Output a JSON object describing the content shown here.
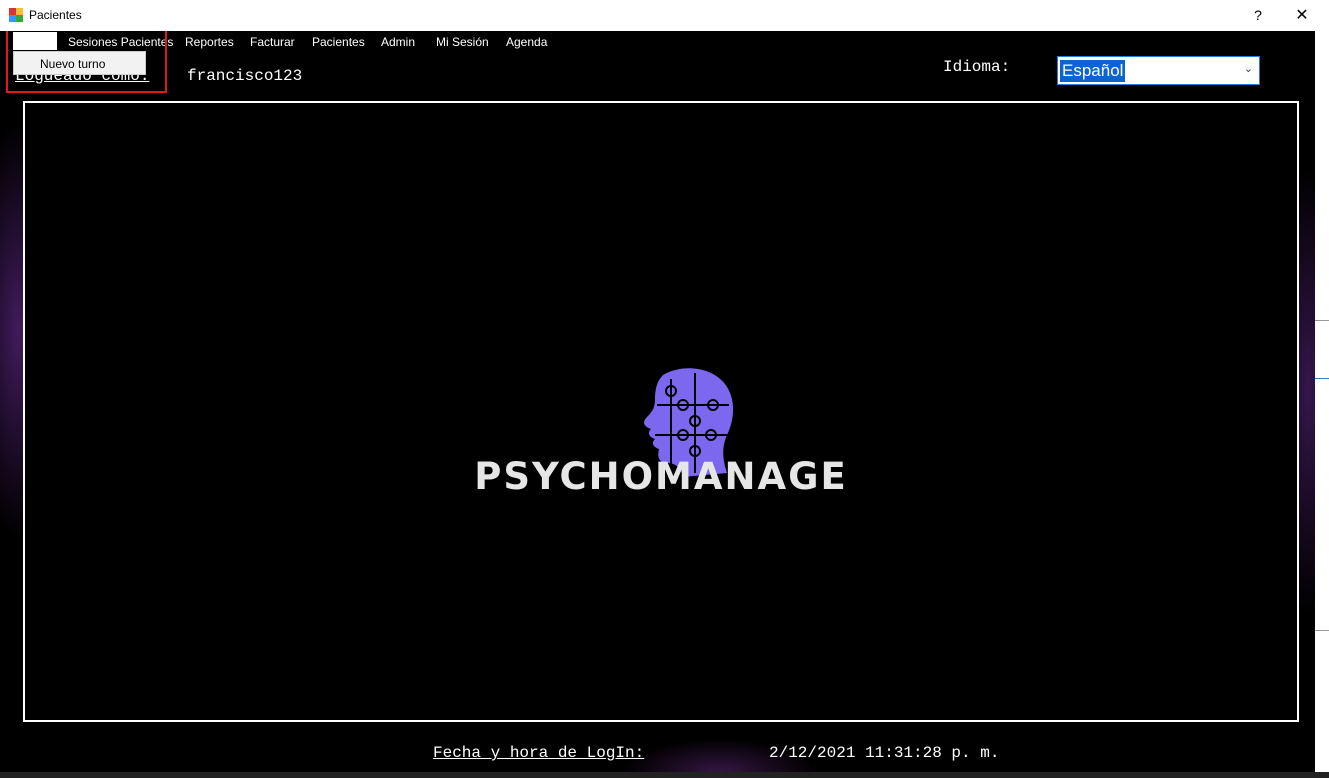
{
  "window": {
    "title": "Pacientes",
    "help_label": "?",
    "close_label": "✕"
  },
  "menu": {
    "items": [
      "Sesiones Pacientes",
      "Reportes",
      "Facturar",
      "Pacientes",
      "Admin",
      "Mi Sesión",
      "Agenda"
    ],
    "dropdown": {
      "items": [
        "Nuevo turno"
      ]
    }
  },
  "header": {
    "logged_label": "Logueado como:",
    "user": "francisco123",
    "language_label": "Idioma:",
    "language_selected": "Español"
  },
  "logo": {
    "text": "PSYCHOMANAGE",
    "color": "#7b68ee"
  },
  "footer": {
    "login_label": "Fecha y hora de LogIn:",
    "login_value": "2/12/2021 11:31:28 p. m."
  },
  "colors": {
    "accent": "#0a64d2",
    "highlight": "#e01818"
  }
}
